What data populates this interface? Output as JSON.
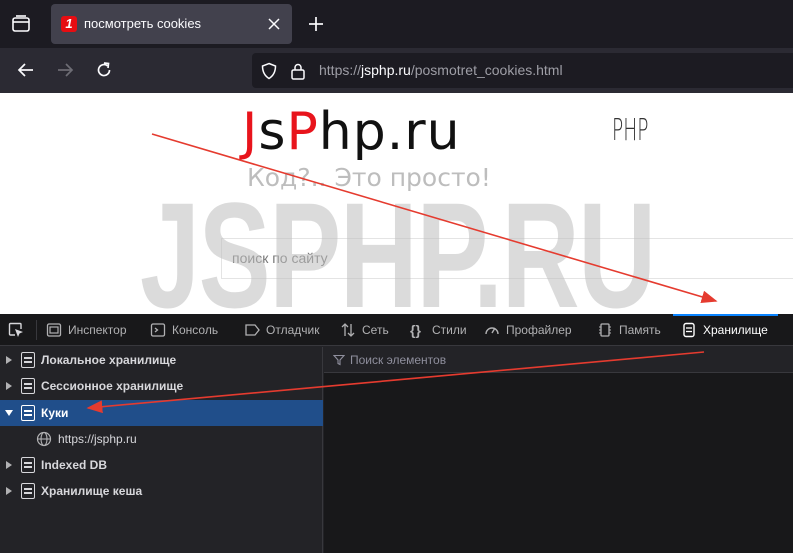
{
  "browser": {
    "tab": {
      "title": "посмотреть cookies",
      "favicon_text": "1"
    },
    "url": {
      "scheme": "https://",
      "host": "jsphp.ru",
      "path": "/posmotret_cookies.html"
    }
  },
  "page": {
    "logo": {
      "p1": "J",
      "p2": "s",
      "p3": "P",
      "p4": "hp.ru"
    },
    "php_mark": "PHP",
    "slogan": "Код?.. Это просто!",
    "search_placeholder": "поиск по сайту",
    "watermark": "JSPHP.RU"
  },
  "devtools": {
    "tabs": [
      {
        "label": "Инспектор",
        "icon": "inspector-icon"
      },
      {
        "label": "Консоль",
        "icon": "console-icon"
      },
      {
        "label": "Отладчик",
        "icon": "debugger-icon"
      },
      {
        "label": "Сеть",
        "icon": "network-icon"
      },
      {
        "label": "Стили",
        "icon": "style-editor-icon"
      },
      {
        "label": "Профайлер",
        "icon": "profiler-icon"
      },
      {
        "label": "Память",
        "icon": "memory-icon"
      },
      {
        "label": "Хранилище",
        "icon": "storage-icon"
      }
    ],
    "selected_tab": "Хранилище",
    "tree": [
      {
        "label": "Локальное хранилище",
        "expanded": false
      },
      {
        "label": "Сессионное хранилище",
        "expanded": false
      },
      {
        "label": "Куки",
        "expanded": true,
        "selected": true
      },
      {
        "label": "Indexed DB",
        "expanded": false
      },
      {
        "label": "Хранилище кеша",
        "expanded": false
      }
    ],
    "cookie_host": "https://jsphp.ru",
    "filter_placeholder": "Поиск элементов"
  },
  "colors": {
    "accent": "#0a84ff",
    "selection": "#204e8a",
    "annotation_arrow": "#e53b2f",
    "logo_red": "#e8141c"
  }
}
